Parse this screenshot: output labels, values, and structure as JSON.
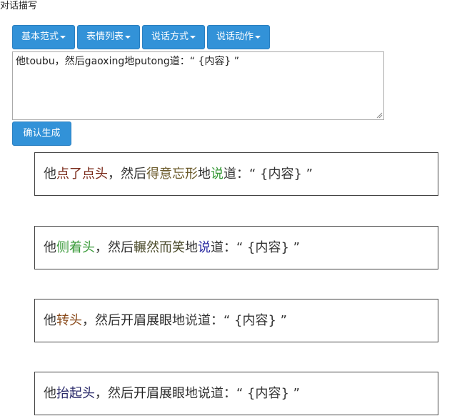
{
  "page": {
    "title": "对话描写"
  },
  "toolbar": {
    "buttons": [
      "基本范式",
      "表情列表",
      "说话方式",
      "说话动作"
    ]
  },
  "editor": {
    "value": "他toubu，然后gaoxing地putong道：“ {内容} ”"
  },
  "confirm_label": "确认生成",
  "results": [
    [
      {
        "text": "他",
        "color": "#333333"
      },
      {
        "text": "点了点头",
        "color": "#7a2a1a"
      },
      {
        "text": "，然后",
        "color": "#333333"
      },
      {
        "text": "得意忘形",
        "color": "#6b5a2a"
      },
      {
        "text": "地",
        "color": "#333333"
      },
      {
        "text": "说",
        "color": "#3a9a3a"
      },
      {
        "text": "道：“ {内容} ”",
        "color": "#333333"
      }
    ],
    [
      {
        "text": "他",
        "color": "#333333"
      },
      {
        "text": "侧着头",
        "color": "#3a9a3a"
      },
      {
        "text": "，然后",
        "color": "#333333"
      },
      {
        "text": "輾然而笑",
        "color": "#4a4a2a"
      },
      {
        "text": "地",
        "color": "#333333"
      },
      {
        "text": "说",
        "color": "#2a2aa0"
      },
      {
        "text": "道：“ {内容} ”",
        "color": "#333333"
      }
    ],
    [
      {
        "text": "他",
        "color": "#333333"
      },
      {
        "text": "转头",
        "color": "#8a4a1a"
      },
      {
        "text": "，然后",
        "color": "#333333"
      },
      {
        "text": "开眉展眼",
        "color": "#222222"
      },
      {
        "text": "地",
        "color": "#333333"
      },
      {
        "text": "说",
        "color": "#4a4a4a"
      },
      {
        "text": "道：“ {内容} ”",
        "color": "#333333"
      }
    ],
    [
      {
        "text": "他",
        "color": "#333333"
      },
      {
        "text": "抬起头",
        "color": "#2a2a6a"
      },
      {
        "text": "，然后",
        "color": "#333333"
      },
      {
        "text": "开眉展眼",
        "color": "#222222"
      },
      {
        "text": "地",
        "color": "#333333"
      },
      {
        "text": "说",
        "color": "#333333"
      },
      {
        "text": "道：“ {内容} ”",
        "color": "#333333"
      }
    ]
  ]
}
